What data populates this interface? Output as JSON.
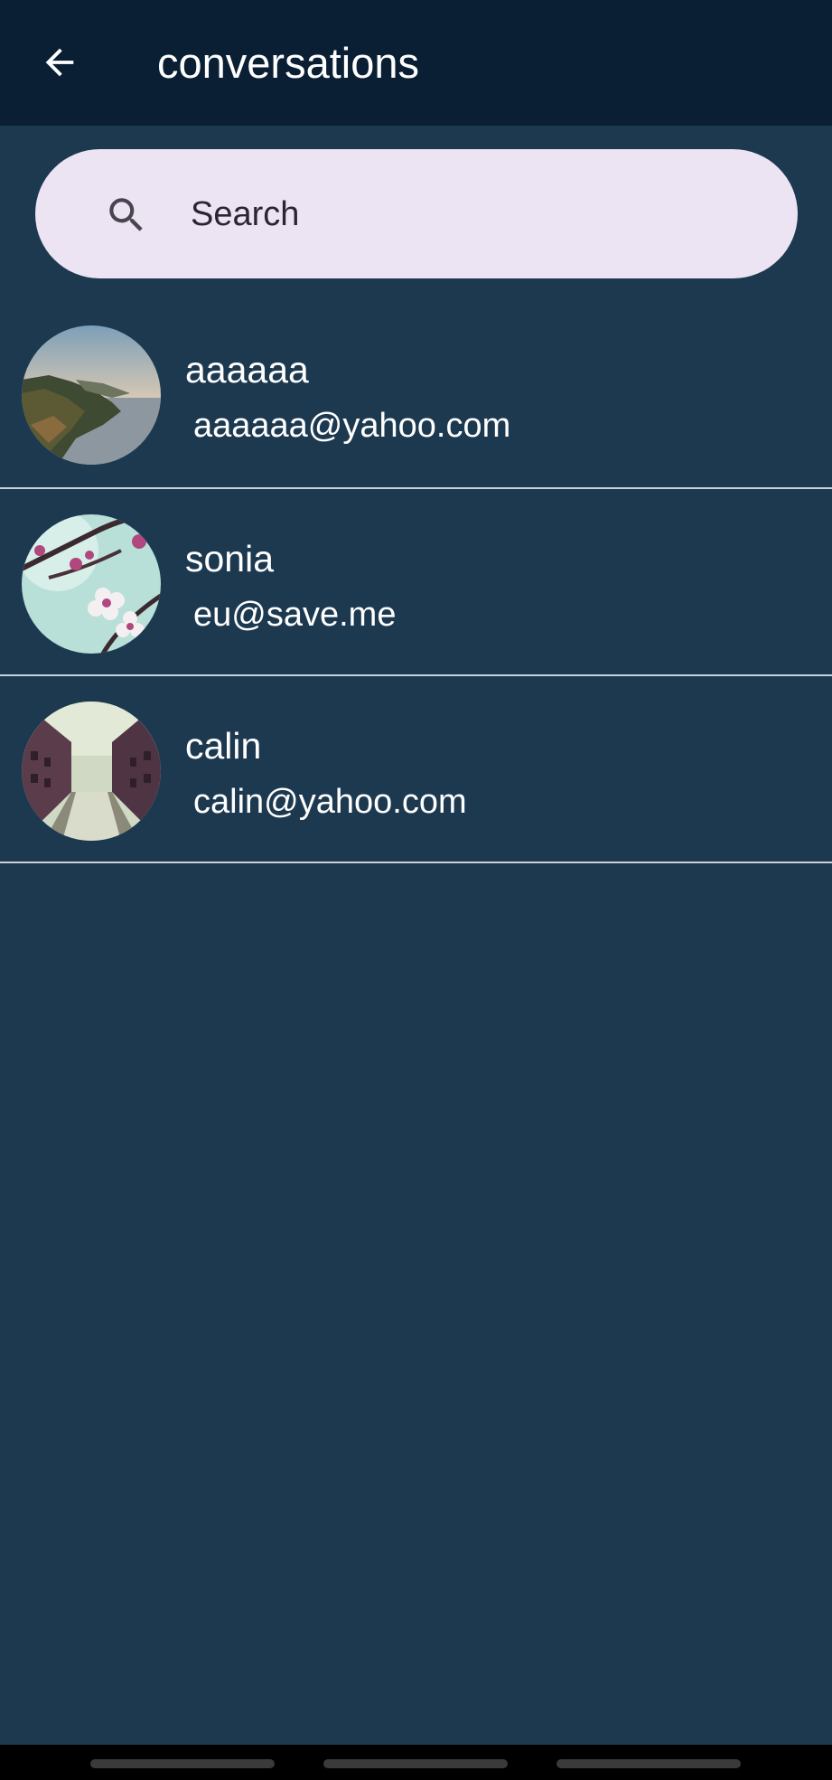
{
  "app_bar": {
    "title": "conversations",
    "back_icon": "arrow-left-icon"
  },
  "search": {
    "placeholder": "Search",
    "value": "",
    "icon": "search-icon"
  },
  "conversations": [
    {
      "name": "aaaaaa",
      "email": "aaaaaa@yahoo.com",
      "avatar": "coastal-landscape"
    },
    {
      "name": "sonia",
      "email": "eu@save.me",
      "avatar": "cherry-blossom"
    },
    {
      "name": "calin",
      "email": "calin@yahoo.com",
      "avatar": "canal-street"
    }
  ],
  "colors": {
    "background": "#1d3950",
    "app_bar": "#0b1f34",
    "search_field": "#ede4f3",
    "divider": "#c9d1d8",
    "text": "#ffffff"
  }
}
